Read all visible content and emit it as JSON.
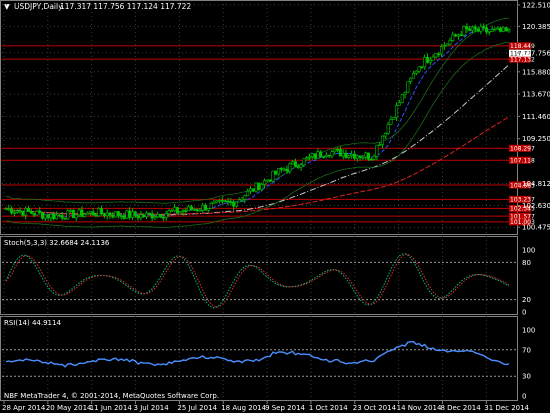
{
  "window": {
    "title": "USDJPY,Daily",
    "ohlc": "117.317 117.756 117.124 117.722",
    "copyright": "NBF MetaTrader 4, © 2001-2014, MetaQuotes Software Corp."
  },
  "colors": {
    "background": "#000000",
    "grid": "#3a3a3a",
    "axis": "#808080",
    "candle": "#00c000",
    "hline": "#c00000",
    "ma_fast": "#3050ff",
    "ma_slow": "#e02020",
    "ma_white": "#c8c8c8",
    "stoch_main": "#00c080",
    "stoch_signal": "#e03030",
    "rsi": "#4a8fff",
    "price_marker_bg": "#c00000",
    "price_marker_fg": "#ffffff",
    "current_price_bg": "#ffffff"
  },
  "main_chart": {
    "price_axis": [
      "122.510",
      "120.385",
      "117.756",
      "115.880",
      "113.670",
      "111.460",
      "109.250",
      "104.812",
      "102.630",
      "100.475"
    ],
    "ylim": [
      100.0,
      122.6
    ],
    "level_labels": [
      "118.449",
      "117.132",
      "108.297",
      "107.118",
      "104.663",
      "103.237",
      "102.345",
      "101.577",
      "101.003"
    ],
    "current_price": "117.722"
  },
  "stoch_panel": {
    "label": "Stoch(5,3,3) 32.6684 24.1136",
    "ticks": [
      "100",
      "80",
      "20",
      "0"
    ]
  },
  "rsi_panel": {
    "label": "RSI(14) 44.9114",
    "ticks": [
      "100",
      "70",
      "30",
      "0"
    ]
  },
  "time_axis": [
    "28 Apr 2014",
    "20 May 2014",
    "11 Jun 2014",
    "3 Jul 2014",
    "25 Jul 2014",
    "18 Aug 2014",
    "9 Sep 2014",
    "1 Oct 2014",
    "23 Oct 2014",
    "14 Nov 2014",
    "8 Dec 2014",
    "31 Dec 2014"
  ],
  "chart_data": {
    "type": "line",
    "title": "USDJPY,Daily",
    "xlabel": "",
    "ylabel": "",
    "ylim": [
      100.0,
      122.6
    ],
    "x": [
      "28 Apr 2014",
      "20 May 2014",
      "11 Jun 2014",
      "3 Jul 2014",
      "25 Jul 2014",
      "18 Aug 2014",
      "9 Sep 2014",
      "1 Oct 2014",
      "23 Oct 2014",
      "14 Nov 2014",
      "8 Dec 2014",
      "31 Dec 2014"
    ],
    "series": [
      {
        "values": [
          102.3,
          101.6,
          101.9,
          101.6,
          102.2,
          103.0,
          106.1,
          108.0,
          107.5,
          116.4,
          120.0,
          119.8
        ]
      }
    ],
    "horizontal_levels": [
      118.449,
      117.132,
      108.297,
      107.118,
      104.663,
      103.237,
      102.345,
      101.577,
      101.003
    ]
  }
}
